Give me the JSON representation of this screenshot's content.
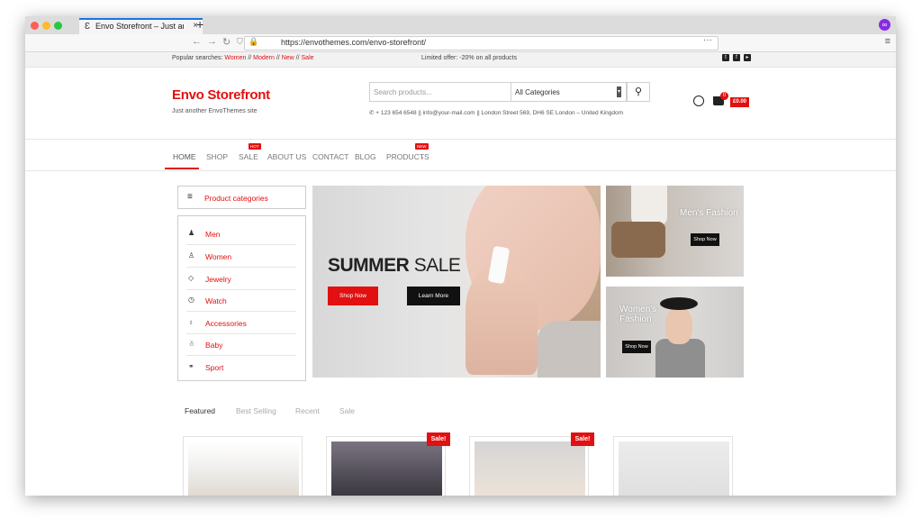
{
  "browser": {
    "tab_title": "Envo Storefront – Just an",
    "tab_close": "×",
    "new_tab": "+",
    "url": "https://envothemes.com/envo-storefront/",
    "url_more": "···"
  },
  "topbar": {
    "popular_label": "Popular searches:",
    "popular_links": [
      "Women",
      "Modern",
      "New",
      "Sale"
    ],
    "separator": "//",
    "offer": "Limited offer: -20% on all products"
  },
  "header": {
    "logo": "Envo Storefront",
    "tagline": "Just another EnvoThemes site",
    "search_placeholder": "Search products...",
    "category_select": "All Categories",
    "contact": "+ 123 654 6548 || info@your-mail.com || London Street 569, DH6 SE London – United Kingdom",
    "cart_count": "0",
    "cart_total": "£0.00"
  },
  "nav": {
    "items": [
      "HOME",
      "SHOP",
      "SALE",
      "ABOUT US",
      "CONTACT",
      "BLOG",
      "PRODUCTS"
    ],
    "badge_hot": "HOT",
    "badge_new": "NEW"
  },
  "categories": {
    "header": "Product categories",
    "items": [
      {
        "label": "Men",
        "icon": "man-icon"
      },
      {
        "label": "Women",
        "icon": "woman-icon"
      },
      {
        "label": "Jewelry",
        "icon": "diamond-icon"
      },
      {
        "label": "Watch",
        "icon": "clock-icon"
      },
      {
        "label": "Accessories",
        "icon": "lightbulb-icon"
      },
      {
        "label": "Baby",
        "icon": "baby-icon"
      },
      {
        "label": "Sport",
        "icon": "bicycle-icon"
      }
    ]
  },
  "hero": {
    "title_bold": "SUMMER",
    "title_light": "SALE",
    "shop_now": "Shop Now",
    "learn_more": "Learn More"
  },
  "promos": [
    {
      "title": "Men's Fashion",
      "button": "Shop Now"
    },
    {
      "title_line1": "Women's",
      "title_line2": "Fashion",
      "button": "Shop Now"
    }
  ],
  "product_tabs": [
    "Featured",
    "Best Selling",
    "Recent",
    "Sale"
  ],
  "sale_badge": "Sale!",
  "colors": {
    "accent": "#e21010",
    "dark": "#111111"
  }
}
